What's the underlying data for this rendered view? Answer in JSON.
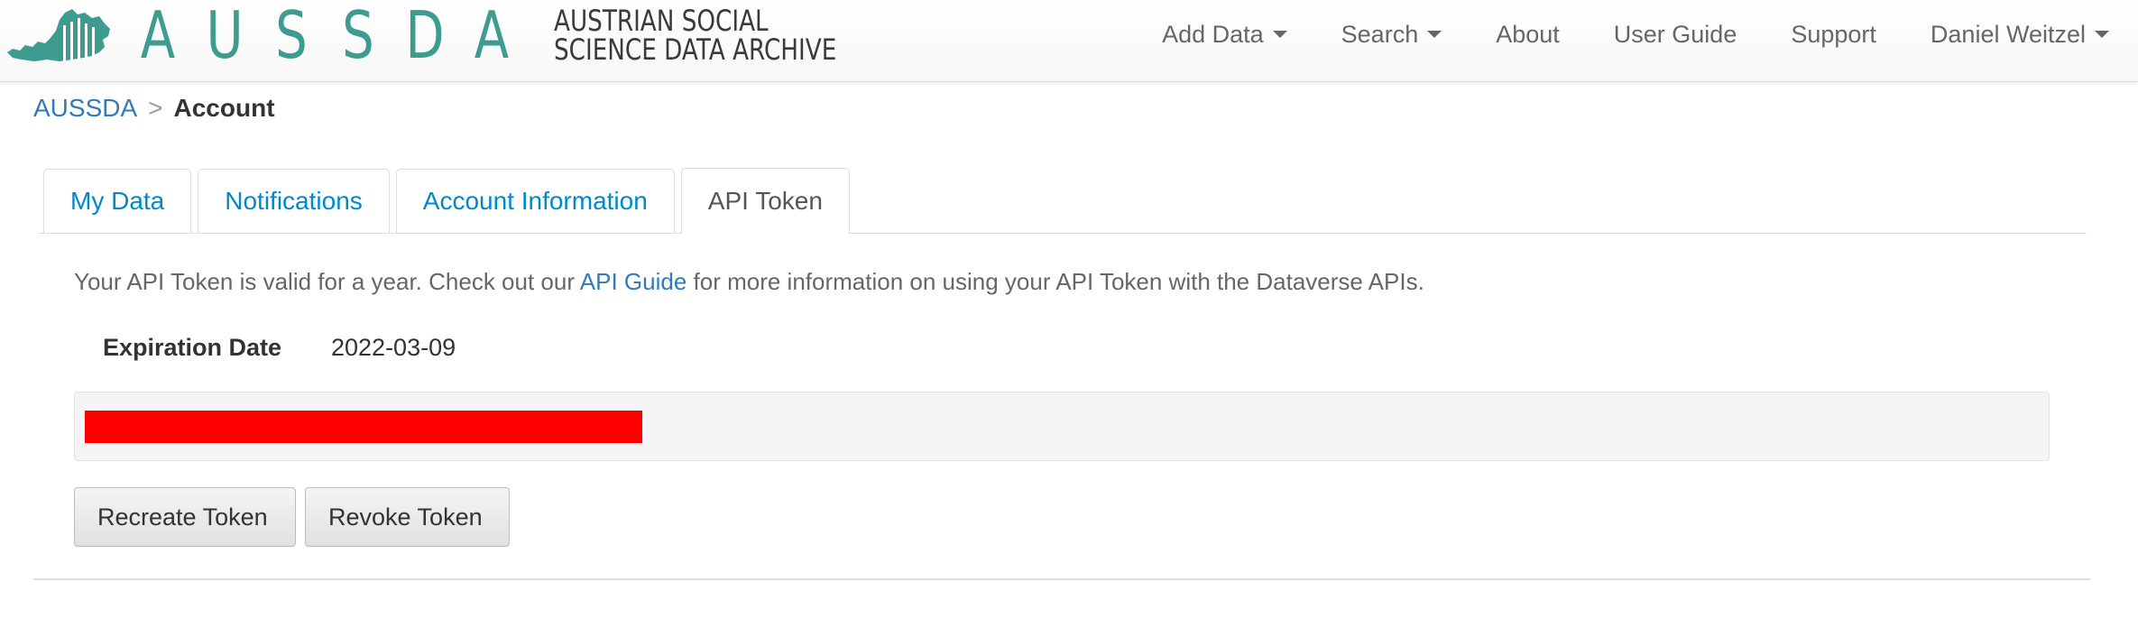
{
  "brand": {
    "letters": [
      "A",
      "U",
      "S",
      "S",
      "D",
      "A"
    ],
    "subtitle_line1": "AUSTRIAN SOCIAL",
    "subtitle_line2": "SCIENCE DATA ARCHIVE",
    "color": "#3e9b8f"
  },
  "nav": {
    "add_data": "Add Data",
    "search": "Search",
    "about": "About",
    "user_guide": "User Guide",
    "support": "Support",
    "user": "Daniel Weitzel"
  },
  "breadcrumb": {
    "root": "AUSSDA",
    "separator": ">",
    "current": "Account"
  },
  "tabs": {
    "my_data": "My Data",
    "notifications": "Notifications",
    "account_information": "Account Information",
    "api_token": "API Token",
    "active": "API Token"
  },
  "api_token": {
    "intro_before": "Your API Token is valid for a year. Check out our ",
    "intro_link": "API Guide",
    "intro_after": " for more information on using your API Token with the Dataverse APIs.",
    "expiration_label": "Expiration Date",
    "expiration_value": "2022-03-09",
    "redaction_color": "#ff0000"
  },
  "buttons": {
    "recreate": "Recreate Token",
    "revoke": "Revoke Token"
  }
}
